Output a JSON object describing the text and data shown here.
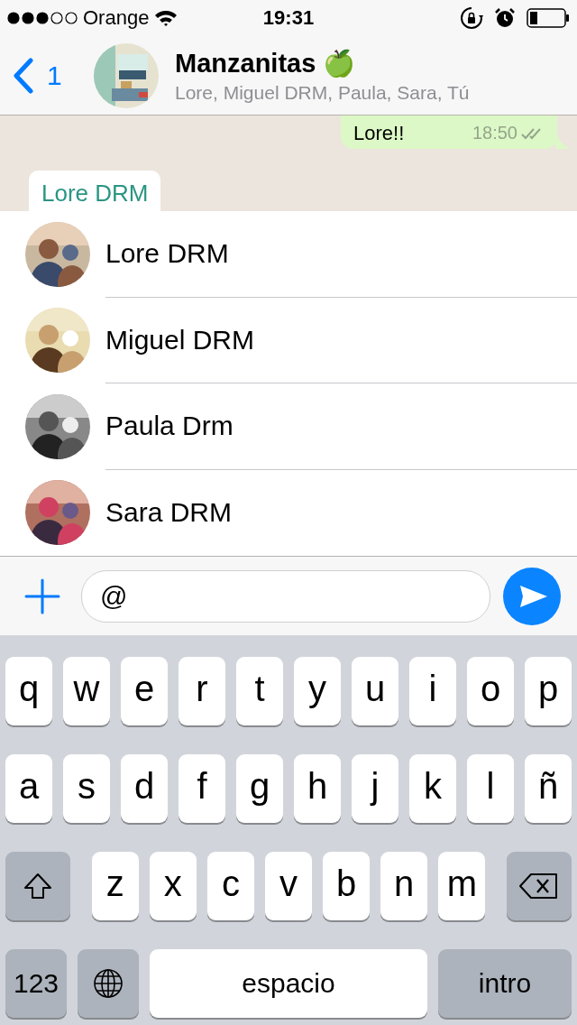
{
  "status_bar": {
    "signal_dots": [
      {
        "filled": true
      },
      {
        "filled": true
      },
      {
        "filled": true
      },
      {
        "filled": false
      },
      {
        "filled": false
      }
    ],
    "carrier": "Orange",
    "time": "19:31"
  },
  "header": {
    "back_count": "1",
    "title": "Manzanitas",
    "title_emoji": "🍏",
    "subtitle": "Lore, Miguel DRM, Paula, Sara, Tú"
  },
  "messages": [
    {
      "kind": "outgoing",
      "text": "Lore!!",
      "time": "18:50"
    },
    {
      "kind": "incoming_sender",
      "sender": "Lore DRM"
    }
  ],
  "mentions": [
    {
      "name": "Lore DRM"
    },
    {
      "name": "Miguel DRM"
    },
    {
      "name": "Paula Drm"
    },
    {
      "name": "Sara DRM"
    }
  ],
  "composer": {
    "value": "@"
  },
  "keyboard": [
    [
      {
        "kind": "letter",
        "label": "q"
      },
      {
        "kind": "letter",
        "label": "w"
      },
      {
        "kind": "letter",
        "label": "e"
      },
      {
        "kind": "letter",
        "label": "r"
      },
      {
        "kind": "letter",
        "label": "t"
      },
      {
        "kind": "letter",
        "label": "y"
      },
      {
        "kind": "letter",
        "label": "u"
      },
      {
        "kind": "letter",
        "label": "i"
      },
      {
        "kind": "letter",
        "label": "o"
      },
      {
        "kind": "letter",
        "label": "p"
      }
    ],
    [
      {
        "kind": "letter",
        "label": "a"
      },
      {
        "kind": "letter",
        "label": "s"
      },
      {
        "kind": "letter",
        "label": "d"
      },
      {
        "kind": "letter",
        "label": "f"
      },
      {
        "kind": "letter",
        "label": "g"
      },
      {
        "kind": "letter",
        "label": "h"
      },
      {
        "kind": "letter",
        "label": "j"
      },
      {
        "kind": "letter",
        "label": "k"
      },
      {
        "kind": "letter",
        "label": "l"
      },
      {
        "kind": "letter",
        "label": "ñ"
      }
    ],
    [
      {
        "kind": "shift"
      },
      {
        "kind": "letter",
        "label": "z"
      },
      {
        "kind": "letter",
        "label": "x"
      },
      {
        "kind": "letter",
        "label": "c"
      },
      {
        "kind": "letter",
        "label": "v"
      },
      {
        "kind": "letter",
        "label": "b"
      },
      {
        "kind": "letter",
        "label": "n"
      },
      {
        "kind": "letter",
        "label": "m"
      },
      {
        "kind": "backspace"
      }
    ],
    [
      {
        "kind": "mode",
        "label": "123"
      },
      {
        "kind": "globe"
      },
      {
        "kind": "space",
        "label": "espacio"
      },
      {
        "kind": "return",
        "label": "intro"
      }
    ]
  ]
}
